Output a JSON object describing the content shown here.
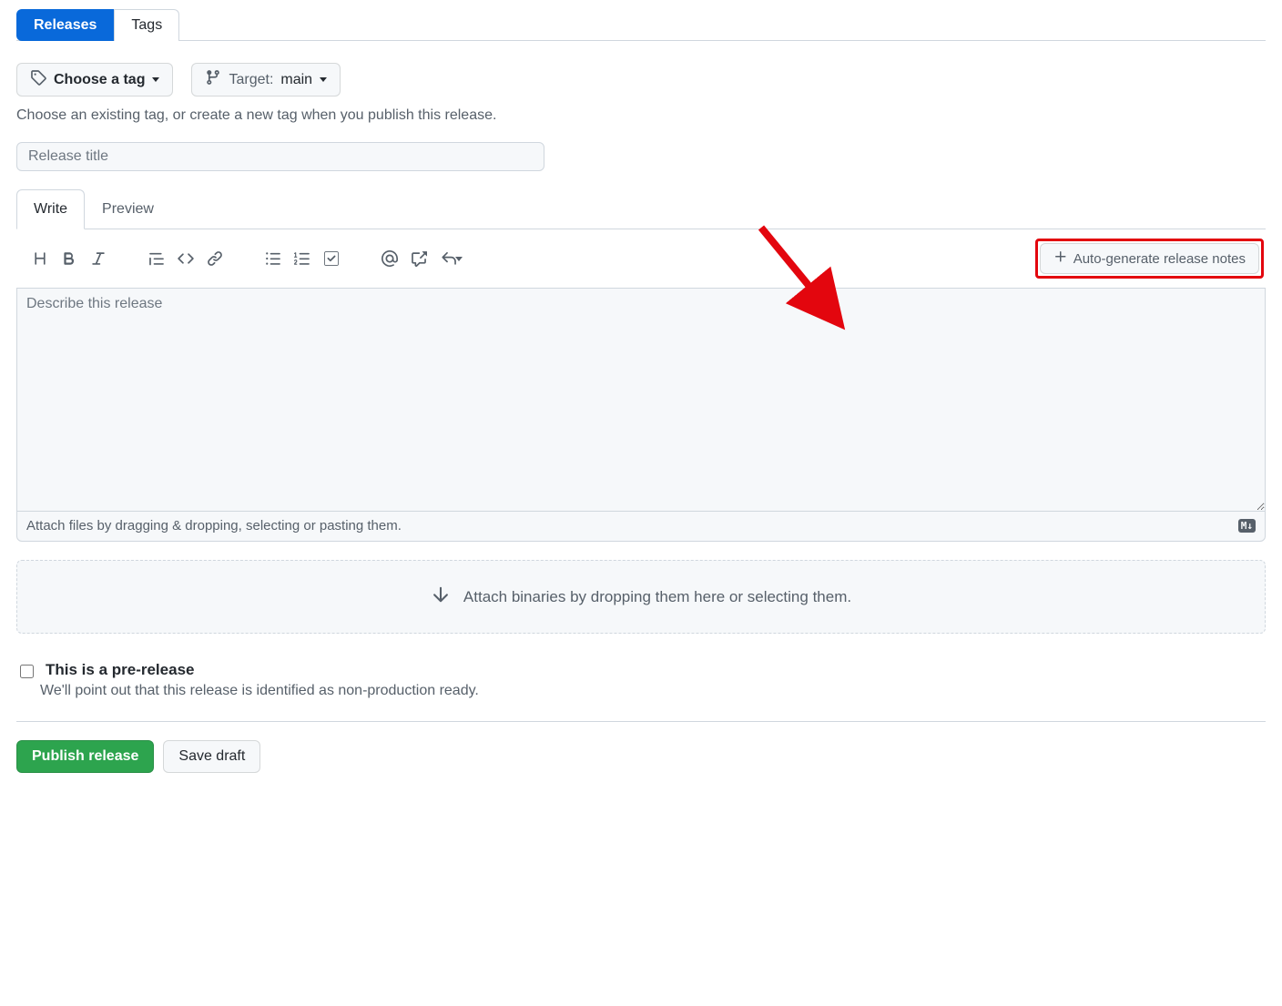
{
  "nav": {
    "releases": "Releases",
    "tags": "Tags"
  },
  "tagSelector": {
    "label": "Choose a tag"
  },
  "targetSelector": {
    "label": "Target:",
    "value": "main"
  },
  "tagHint": "Choose an existing tag, or create a new tag when you publish this release.",
  "titleInput": {
    "placeholder": "Release title",
    "value": ""
  },
  "editorTabs": {
    "write": "Write",
    "preview": "Preview"
  },
  "autoGenerate": "Auto-generate release notes",
  "description": {
    "placeholder": "Describe this release",
    "value": ""
  },
  "attachFiles": "Attach files by dragging & dropping, selecting or pasting them.",
  "markdownBadge": "M↓",
  "attachBinaries": "Attach binaries by dropping them here or selecting them.",
  "prerelease": {
    "title": "This is a pre-release",
    "subtitle": "We'll point out that this release is identified as non-production ready."
  },
  "actions": {
    "publish": "Publish release",
    "saveDraft": "Save draft"
  }
}
